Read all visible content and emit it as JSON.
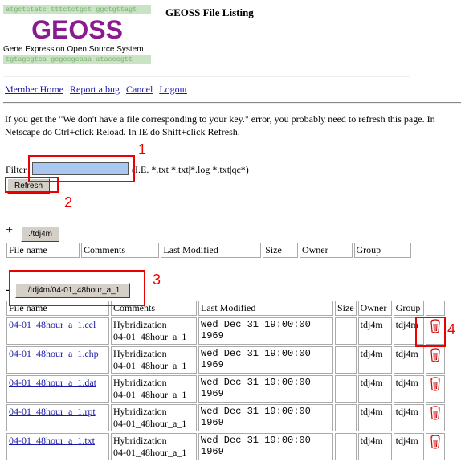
{
  "page_title": "GEOSS File Listing",
  "logo": {
    "dna_top": "atgctctatc tttctctgct ggctgttagt",
    "name": "GEOSS",
    "tagline": "Gene Expression Open Source System",
    "dna_bottom": "tgtagcgtca gcgccgcaaa atacccgtt"
  },
  "nav": {
    "member_home": "Member Home",
    "report_bug": "Report a bug",
    "cancel": "Cancel",
    "logout": "Logout"
  },
  "message": "If you get the \"We don't have a file corresponding to your key.\" error, you probably need to refresh this page. In Netscape do Ctrl+click Reload. In IE do Shift+click Refresh.",
  "filter": {
    "label": "Filter",
    "value": "",
    "hint": "(I.E. *.txt *.txt|*.log *.txt|qc*)",
    "refresh_label": "Refresh"
  },
  "folder1": {
    "expand": "+",
    "button": "./tdj4m",
    "headers": [
      "File name",
      "Comments",
      "Last Modified",
      "Size",
      "Owner",
      "Group"
    ]
  },
  "folder2": {
    "expand": "-",
    "button": "./tdj4m/04-01_48hour_a_1",
    "headers": [
      "File name",
      "Comments",
      "Last Modified",
      "Size",
      "Owner",
      "Group"
    ],
    "rows": [
      {
        "name": "04-01_48hour_a_1.cel",
        "comment1": "Hybridization",
        "comment2": "04-01_48hour_a_1",
        "modified": "Wed Dec 31 19:00:00 1969",
        "size": "",
        "owner": "tdj4m",
        "group": "tdj4m"
      },
      {
        "name": "04-01_48hour_a_1.chp",
        "comment1": "Hybridization",
        "comment2": "04-01_48hour_a_1",
        "modified": "Wed Dec 31 19:00:00 1969",
        "size": "",
        "owner": "tdj4m",
        "group": "tdj4m"
      },
      {
        "name": "04-01_48hour_a_1.dat",
        "comment1": "Hybridization",
        "comment2": "04-01_48hour_a_1",
        "modified": "Wed Dec 31 19:00:00 1969",
        "size": "",
        "owner": "tdj4m",
        "group": "tdj4m"
      },
      {
        "name": "04-01_48hour_a_1.rpt",
        "comment1": "Hybridization",
        "comment2": "04-01_48hour_a_1",
        "modified": "Wed Dec 31 19:00:00 1969",
        "size": "",
        "owner": "tdj4m",
        "group": "tdj4m"
      },
      {
        "name": "04-01_48hour_a_1.txt",
        "comment1": "Hybridization",
        "comment2": "04-01_48hour_a_1",
        "modified": "Wed Dec 31 19:00:00 1969",
        "size": "",
        "owner": "tdj4m",
        "group": "tdj4m"
      }
    ]
  },
  "annotations": [
    "1",
    "2",
    "3",
    "4"
  ],
  "colors": {
    "annotation": "#e00000",
    "link": "#1a1aaa",
    "logo": "#8b1a8e",
    "input_bg": "#a8c8f0"
  },
  "icons": {
    "delete": "trash-can-icon"
  }
}
